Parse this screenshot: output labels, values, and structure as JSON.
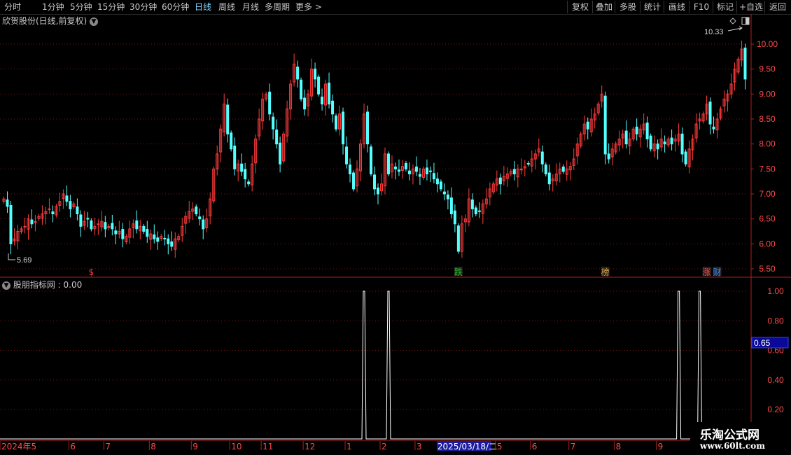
{
  "toolbar": {
    "periods": [
      "分时",
      "1分钟",
      "5分钟",
      "15分钟",
      "30分钟",
      "60分钟",
      "日线",
      "周线",
      "月线",
      "多周期",
      "更多 >"
    ],
    "selected": "日线",
    "right_buttons": [
      "复权",
      "叠加",
      "多股",
      "统计",
      "画线",
      "F10",
      "标记",
      "+自选",
      "返回"
    ]
  },
  "main_panel": {
    "title": "欣贺股份(日线,前复权)",
    "high_label": "10.33",
    "low_label": "5.69",
    "markers": [
      {
        "text": "$",
        "color": "#ff3b3b",
        "date_index": 25
      },
      {
        "text": "跌",
        "color": "#22bb22",
        "date_index": 130
      },
      {
        "text": "榜",
        "color": "#d8a040",
        "date_index": 172
      },
      {
        "text": "涨",
        "color": "#ff4444",
        "date_index": 201
      },
      {
        "text": "财",
        "color": "#3a8cff",
        "date_index": 204
      }
    ]
  },
  "indicator_panel": {
    "title": "股朋指标网 : 0.00",
    "current_value_tag": "0.65",
    "signals": [
      {
        "date_index": 103,
        "value": 1.0
      },
      {
        "date_index": 110,
        "value": 1.0
      },
      {
        "date_index": 193,
        "value": 1.0
      },
      {
        "date_index": 199,
        "value": 1.0
      }
    ]
  },
  "axis": {
    "price_ticks": [
      "10.00",
      "9.50",
      "9.00",
      "8.50",
      "8.00",
      "7.50",
      "7.00",
      "6.50",
      "6.00",
      "5.50"
    ],
    "indicator_ticks": [
      "1.00",
      "0.80",
      "0.60",
      "0.40",
      "0.20"
    ],
    "date_labels": [
      {
        "text": "2024年5",
        "date_index": 0
      },
      {
        "text": "6",
        "date_index": 19
      },
      {
        "text": "7",
        "date_index": 29
      },
      {
        "text": "8",
        "date_index": 42
      },
      {
        "text": "9",
        "date_index": 54
      },
      {
        "text": "10",
        "date_index": 65
      },
      {
        "text": "11",
        "date_index": 74
      },
      {
        "text": "12",
        "date_index": 86
      },
      {
        "text": "1",
        "date_index": 98
      },
      {
        "text": "2",
        "date_index": 108
      },
      {
        "text": "3",
        "date_index": 118
      },
      {
        "text": "2025/03/18/二",
        "date_index": 124,
        "highlight": true
      },
      {
        "text": "5",
        "date_index": 141
      },
      {
        "text": "6",
        "date_index": 151
      },
      {
        "text": "7",
        "date_index": 162
      },
      {
        "text": "8",
        "date_index": 175
      },
      {
        "text": "9",
        "date_index": 187
      }
    ]
  },
  "watermark": {
    "line1": "乐淘公式网",
    "line2": "www.60lt.com"
  },
  "chart_data": {
    "type": "candlestick",
    "series_count_days": 216,
    "price_range": [
      5.4,
      10.45
    ],
    "indicator_range": [
      0,
      1.05
    ],
    "closes": [
      6.9,
      6.75,
      6.0,
      6.1,
      6.25,
      6.3,
      6.35,
      6.5,
      6.4,
      6.45,
      6.55,
      6.6,
      6.65,
      6.7,
      6.6,
      6.75,
      6.85,
      7.0,
      6.85,
      6.7,
      6.8,
      6.6,
      6.35,
      6.45,
      6.5,
      6.3,
      6.35,
      6.4,
      6.45,
      6.3,
      6.35,
      6.3,
      6.2,
      6.25,
      6.1,
      6.15,
      6.3,
      6.4,
      6.3,
      6.35,
      6.25,
      6.15,
      6.2,
      6.1,
      6.05,
      6.15,
      6.1,
      6.0,
      5.95,
      6.1,
      6.15,
      6.35,
      6.55,
      6.65,
      6.7,
      6.6,
      6.5,
      6.3,
      6.5,
      6.9,
      7.5,
      7.8,
      8.3,
      8.8,
      8.2,
      7.9,
      7.5,
      7.6,
      7.45,
      7.3,
      7.2,
      7.6,
      8.1,
      8.5,
      8.9,
      9.0,
      8.6,
      8.3,
      8.0,
      7.6,
      8.2,
      8.7,
      9.2,
      9.6,
      9.3,
      8.9,
      8.7,
      9.0,
      9.5,
      9.3,
      9.0,
      8.8,
      9.2,
      8.8,
      8.6,
      8.3,
      8.6,
      8.0,
      7.6,
      7.4,
      7.1,
      7.5,
      8.0,
      8.6,
      8.0,
      7.4,
      7.1,
      7.0,
      7.2,
      7.8,
      7.4,
      7.6,
      7.5,
      7.45,
      7.55,
      7.5,
      7.4,
      7.5,
      7.45,
      7.35,
      7.5,
      7.4,
      7.45,
      7.3,
      7.2,
      7.1,
      7.0,
      6.9,
      6.6,
      6.4,
      5.85,
      6.4,
      6.5,
      6.9,
      6.7,
      6.6,
      6.65,
      6.8,
      6.9,
      7.1,
      7.2,
      7.3,
      7.2,
      7.35,
      7.4,
      7.45,
      7.4,
      7.5,
      7.5,
      7.55,
      7.6,
      7.7,
      7.8,
      7.9,
      7.6,
      7.4,
      7.2,
      7.3,
      7.4,
      7.5,
      7.45,
      7.5,
      7.55,
      7.7,
      8.0,
      8.2,
      8.4,
      8.3,
      8.5,
      8.6,
      8.8,
      9.0,
      7.8,
      7.7,
      7.9,
      8.0,
      8.1,
      8.2,
      8.0,
      8.1,
      8.3,
      8.2,
      8.3,
      8.4,
      8.1,
      7.9,
      8.0,
      7.9,
      8.1,
      8.0,
      8.1,
      8.0,
      8.1,
      8.2,
      7.8,
      7.6,
      7.9,
      8.1,
      8.4,
      8.5,
      8.6,
      8.8,
      8.4,
      8.3,
      8.5,
      8.7,
      8.9,
      9.0,
      9.2,
      9.5,
      9.7,
      9.9,
      9.3
    ]
  }
}
